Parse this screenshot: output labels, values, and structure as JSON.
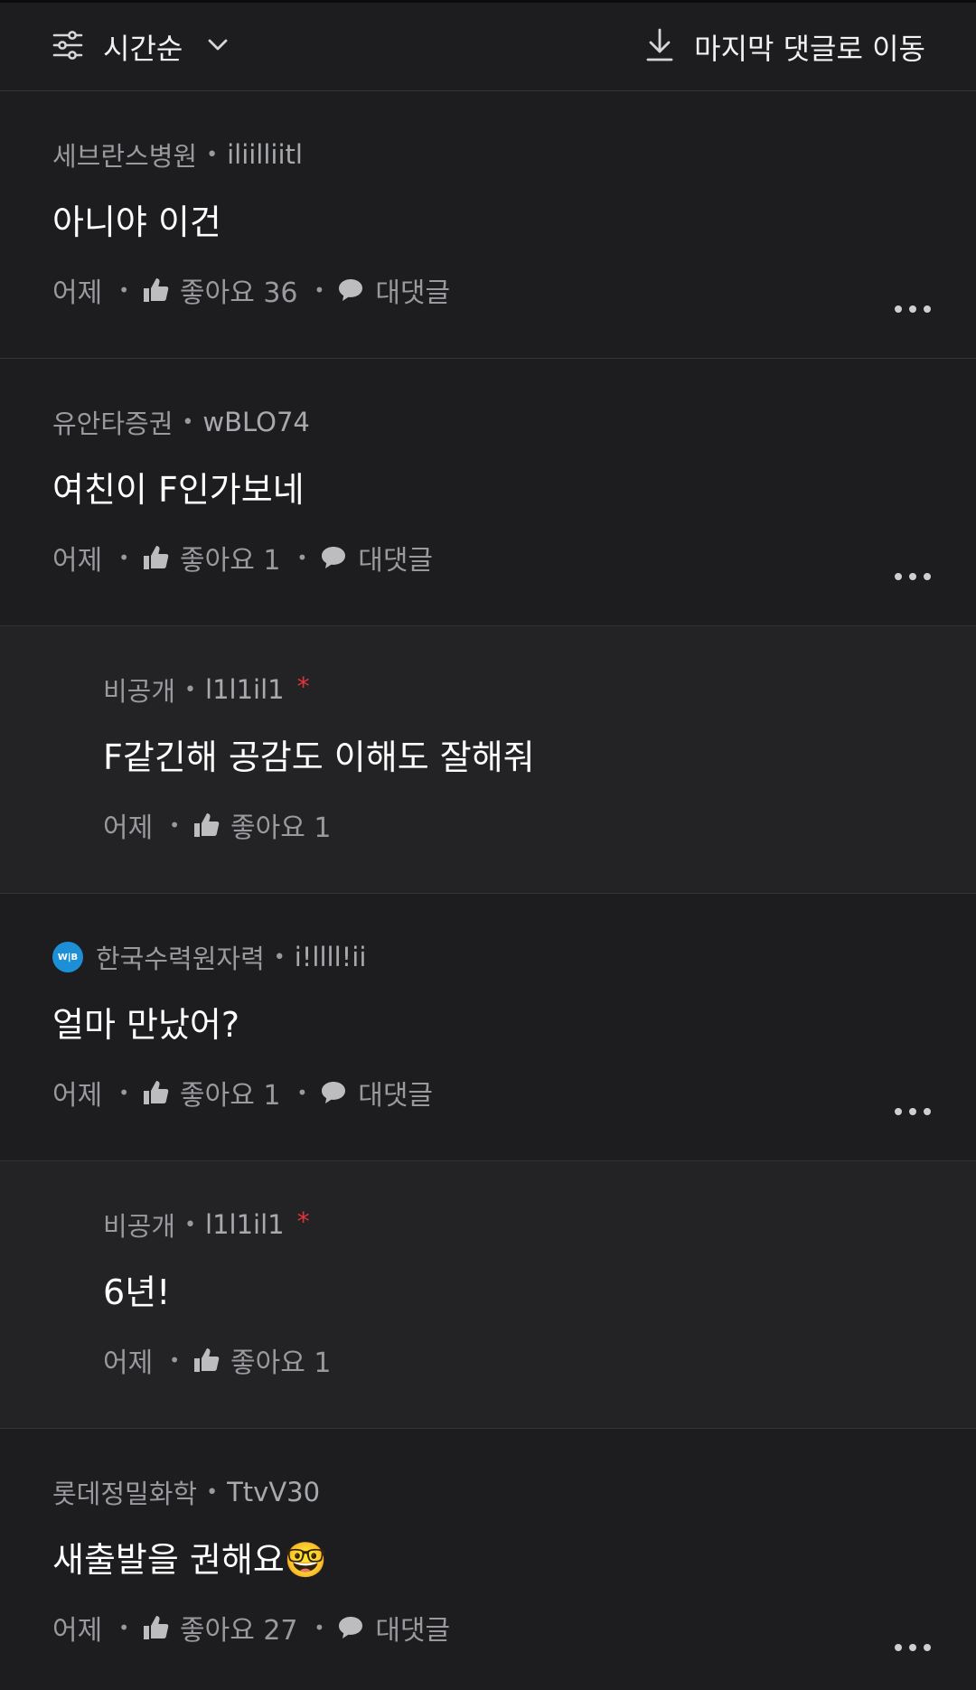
{
  "toolbar": {
    "sort_label": "시간순",
    "jump_label": "마지막 댓글로 이동"
  },
  "comments": [
    {
      "company": "세브란스병원",
      "nick": "iliilliitl",
      "text": "아니야 이건",
      "time": "어제",
      "likes": "좋아요 36",
      "reply_label": "대댓글",
      "is_reply": false
    },
    {
      "company": "유안타증권",
      "nick": "wBLO74",
      "text": "여친이 F인가보네",
      "time": "어제",
      "likes": "좋아요 1",
      "reply_label": "대댓글",
      "is_reply": false
    },
    {
      "company": "비공개",
      "nick": "l1l1il1",
      "author_mark": "*",
      "text": "F같긴해 공감도 이해도 잘해줘",
      "time": "어제",
      "likes": "좋아요 1",
      "is_reply": true
    },
    {
      "company": "한국수력원자력",
      "badge": "W|B",
      "nick": "i!llll!ii",
      "text": "얼마 만났어?",
      "time": "어제",
      "likes": "좋아요 1",
      "reply_label": "대댓글",
      "is_reply": false
    },
    {
      "company": "비공개",
      "nick": "l1l1il1",
      "author_mark": "*",
      "text": "6년!",
      "time": "어제",
      "likes": "좋아요 1",
      "is_reply": true
    },
    {
      "company": "롯데정밀화학",
      "nick": "TtvV30",
      "text": "새출발을 권해요🤓",
      "time": "어제",
      "likes": "좋아요 27",
      "reply_label": "대댓글",
      "is_reply": false
    }
  ],
  "colors": {
    "background": "#1d1d1f",
    "reply_background": "#232325",
    "muted_text": "#9a9a9e",
    "author_mark": "#e1343b",
    "badge": "#1c8fd6"
  },
  "icons": [
    "sliders-icon",
    "chevron-down-icon",
    "download-arrow-icon",
    "thumbs-up-icon",
    "speech-bubble-icon",
    "more-dots-icon"
  ]
}
